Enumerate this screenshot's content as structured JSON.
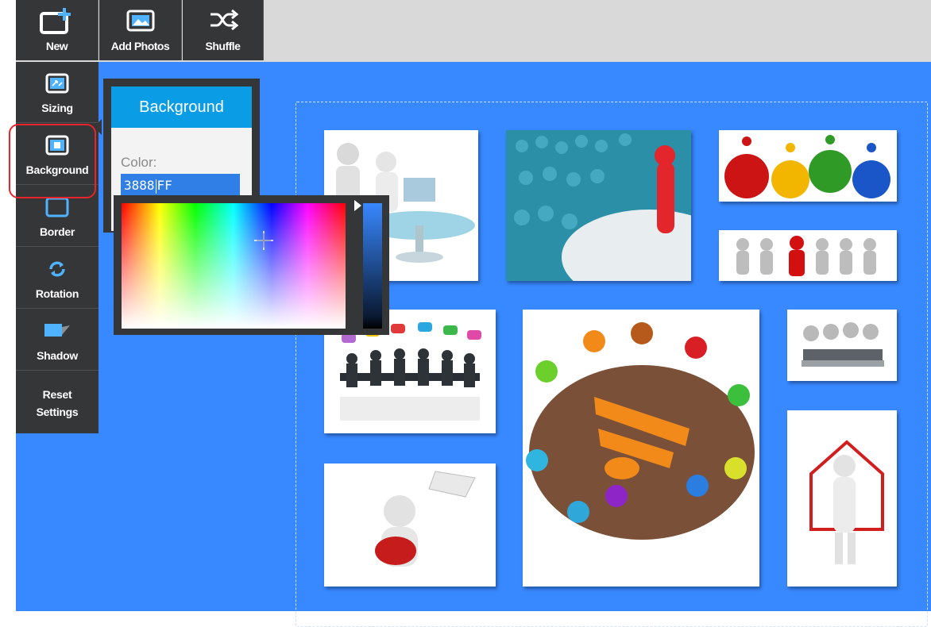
{
  "toolbar": {
    "new_label": "New",
    "add_photos_label": "Add Photos",
    "shuffle_label": "Shuffle"
  },
  "sidebar": {
    "items": [
      {
        "label": "Sizing",
        "icon": "sizing-icon"
      },
      {
        "label": "Background",
        "icon": "background-icon"
      },
      {
        "label": "Border",
        "icon": "border-icon"
      },
      {
        "label": "Rotation",
        "icon": "rotation-icon"
      },
      {
        "label": "Shadow",
        "icon": "shadow-icon"
      },
      {
        "label": "Reset Settings",
        "icon": ""
      }
    ]
  },
  "background_panel": {
    "title": "Background",
    "color_label": "Color:",
    "color_value_before_caret": "3888",
    "color_value_after_caret": "FF"
  },
  "colors": {
    "canvas_background": "#3888ff",
    "toolbar_dark": "#343638",
    "panel_header": "#0a9de6",
    "highlight_ring": "#e8232a"
  },
  "collage": {
    "photos": [
      "business-people-meeting-photo",
      "crowd-red-leader-photo",
      "people-on-gears-photo",
      "team-lineup-photo",
      "speech-bubbles-meeting-photo",
      "round-table-rss-photo",
      "call-center-photo",
      "courier-with-envelope-photo",
      "person-with-house-photo"
    ]
  }
}
